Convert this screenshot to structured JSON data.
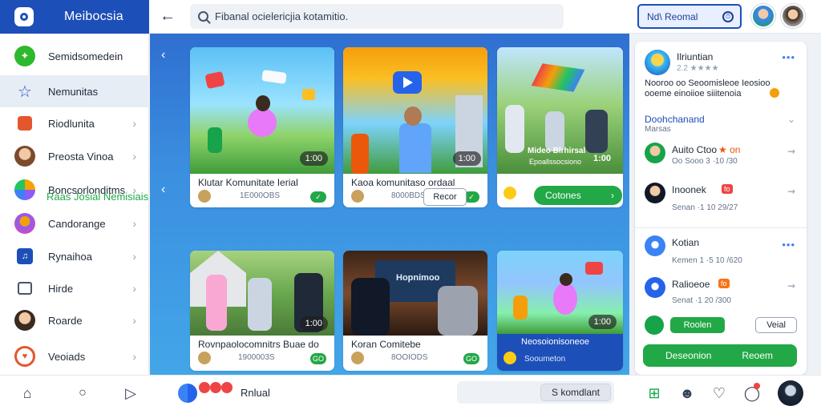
{
  "app": {
    "title": "Meibocsia"
  },
  "search": {
    "placeholder": "Fibanal ocielericjia kotamitio."
  },
  "header": {
    "cta_label": "Nd\\ Reomal"
  },
  "sidebar": {
    "items": [
      {
        "label": "Semidsomedein",
        "icon": "leaf-icon",
        "color": "#2eb82e"
      },
      {
        "label": "Nemunitas",
        "icon": "star-icon",
        "color": "#1d4fb8"
      },
      {
        "label": "Riodlunita",
        "icon": "bookmark-icon",
        "color": "#e4572e"
      },
      {
        "label": "Preosta Vinoa",
        "icon": "avatar-icon",
        "color": "#c98a5a"
      },
      {
        "label": "Boncsorlonditms",
        "icon": "circles-icon",
        "color": "#f4a300"
      },
      {
        "label": "Candorange",
        "icon": "avatar-icon",
        "color": "#8b5cf6"
      },
      {
        "label": "Rynaihoa",
        "icon": "music-icon",
        "color": "#1d4fb8"
      },
      {
        "label": "Hirde",
        "icon": "square-icon",
        "color": "#475569"
      },
      {
        "label": "Roarde",
        "icon": "avatar-icon",
        "color": "#a16207"
      },
      {
        "label": "Veoiads",
        "icon": "heart-icon",
        "color": "#e4572e"
      }
    ]
  },
  "feed": {
    "cards_top": [
      {
        "title": "Klutar Komunitate Ierial",
        "meta": "1E000OBS",
        "duration": "1:00"
      },
      {
        "title": "Kaoa komunitaso ordaal",
        "meta": "8000BDS",
        "duration": "1:00"
      },
      {
        "title": "Mideo Blrhirsal",
        "overlay": "Epoallssocsiono",
        "duration": "1:00",
        "button": "Cotones"
      }
    ],
    "section": {
      "title_part1": "Raas",
      "title_part2": "Josial Nemisiais",
      "button": "Recor"
    },
    "cards_bottom": [
      {
        "title": "Rovnpaolocomnitrs Buae do",
        "meta": "1900003S",
        "duration": "1:00",
        "button": "GO"
      },
      {
        "title": "Koran Comitebe",
        "meta": "8OOIODS",
        "overlay": "Hopnimoo",
        "button": "GO"
      },
      {
        "title": "Neosoionisoneoe",
        "meta": "Sooumeton",
        "duration": "1:00"
      }
    ]
  },
  "rpanel": {
    "header": {
      "title": "Ilriuntian",
      "rating": "2.2 ★★★★",
      "desc": "Nooroo oo Seoomisleoe Ieosioo ooeme einoiioe siiitenoia"
    },
    "group": {
      "title": "Doohchanand",
      "sub": "Marsas"
    },
    "people": [
      {
        "name": "Auito Ctoo",
        "extra": "★ on",
        "meta": "Oo Sooo 3 ·10 /30"
      },
      {
        "name": "Inoonek",
        "extra": "fo",
        "meta": "Senan ·1 10 29/27"
      }
    ],
    "people2": [
      {
        "name": "Kotian",
        "meta": "Kemen 1 ·5 10 /620"
      },
      {
        "name": "Ralioeoe",
        "extra": "fo",
        "meta": "Senat ·1 20 /300"
      }
    ],
    "pill_green": "Roolen",
    "pill_outline": "Veial",
    "big_button_left": "Deseonion",
    "big_button_right": "Reoem"
  },
  "bottombar": {
    "label": "Rnlual",
    "search_chip": "S komdlant"
  }
}
